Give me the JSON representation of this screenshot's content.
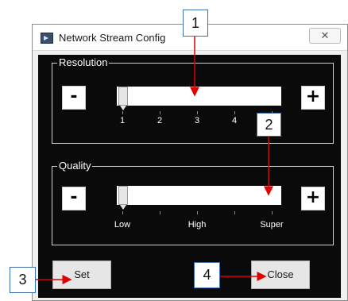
{
  "window": {
    "title": "Network Stream Config",
    "close_glyph": "✕",
    "icon": "app-icon"
  },
  "resolution": {
    "label": "Resolution",
    "minus_label": "-",
    "plus_label": "+",
    "tick_labels": [
      "1",
      "2",
      "3",
      "4",
      ""
    ],
    "selected": "1"
  },
  "quality": {
    "label": "Quality",
    "minus_label": "-",
    "plus_label": "+",
    "tick_labels": [
      "Low",
      "High",
      "Super"
    ],
    "selected": "Low"
  },
  "buttons": {
    "set_label": "Set",
    "close_label": "Close"
  },
  "callouts": [
    "1",
    "2",
    "3",
    "4"
  ],
  "colors": {
    "panel": "#0a0a0a",
    "arrow": "#e00000",
    "callout_border": "#3c6fb0"
  }
}
